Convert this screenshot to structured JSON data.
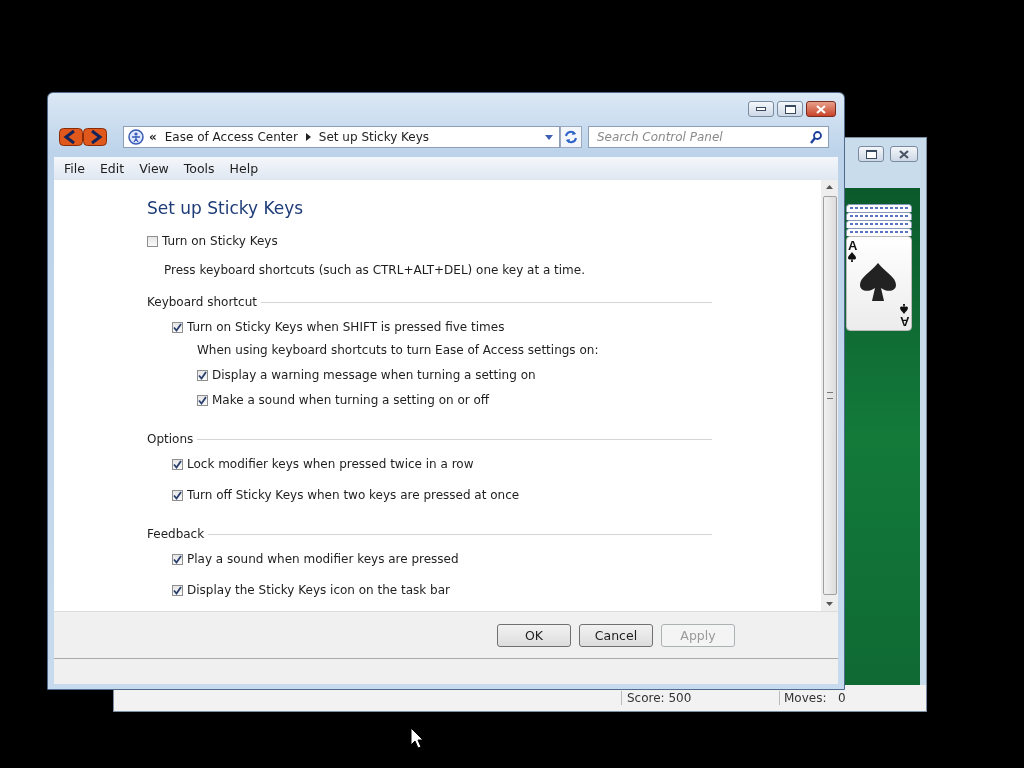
{
  "solitaire_window": {
    "card": {
      "corner_top": "A",
      "corner_bottom": "A"
    },
    "status_bar": {
      "score": "Score: 500",
      "moves_label": "Moves:",
      "moves_value": "0"
    }
  },
  "control_panel_window": {
    "address_bar": {
      "overflow": "«",
      "breadcrumb": [
        "Ease of Access Center",
        "Set up Sticky Keys"
      ]
    },
    "search": {
      "placeholder": "Search Control Panel"
    },
    "menu": [
      "File",
      "Edit",
      "View",
      "Tools",
      "Help"
    ],
    "heading": "Set up Sticky Keys",
    "main_option": {
      "label": "Turn on Sticky Keys",
      "checked": false,
      "description": "Press keyboard shortcuts (such as CTRL+ALT+DEL) one key at a time."
    },
    "sections": [
      {
        "title": "Keyboard shortcut",
        "items": [
          {
            "kind": "checkbox",
            "label": "Turn on Sticky Keys when SHIFT is pressed five times",
            "checked": true,
            "children": [
              {
                "kind": "note",
                "text": "When using keyboard shortcuts to turn Ease of Access settings on:"
              },
              {
                "kind": "checkbox",
                "label": "Display a warning message when turning a setting on",
                "checked": true
              },
              {
                "kind": "checkbox",
                "label": "Make a sound when turning a setting on or off",
                "checked": true
              }
            ]
          }
        ]
      },
      {
        "title": "Options",
        "items": [
          {
            "kind": "checkbox",
            "label": "Lock modifier keys when pressed twice in a row",
            "checked": true
          },
          {
            "kind": "checkbox",
            "label": "Turn off Sticky Keys when two keys are pressed at once",
            "checked": true
          }
        ]
      },
      {
        "title": "Feedback",
        "items": [
          {
            "kind": "checkbox",
            "label": "Play a sound when modifier keys are pressed",
            "checked": true
          },
          {
            "kind": "checkbox",
            "label": "Display the Sticky Keys icon on the task bar",
            "checked": true
          }
        ]
      }
    ],
    "buttons": [
      {
        "label": "OK",
        "disabled": false
      },
      {
        "label": "Cancel",
        "disabled": false
      },
      {
        "label": "Apply",
        "disabled": true
      }
    ]
  }
}
